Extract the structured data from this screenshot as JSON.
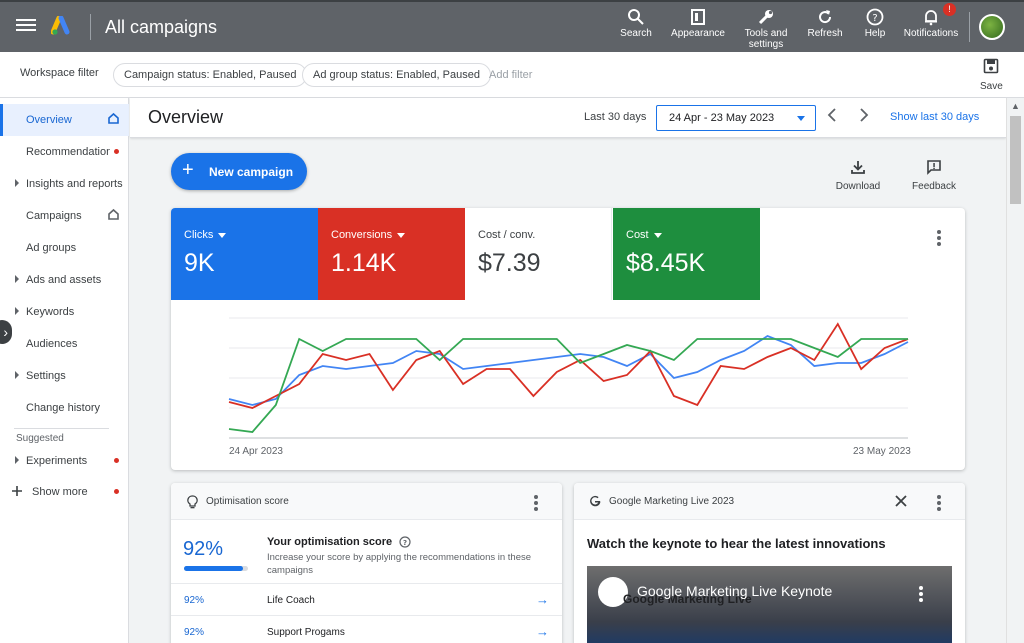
{
  "topbar": {
    "title": "All campaigns",
    "actions": [
      {
        "label": "Search",
        "icon": "search-icon"
      },
      {
        "label": "Appearance",
        "icon": "appearance-icon"
      },
      {
        "label": "Tools and settings",
        "icon": "wrench-icon"
      },
      {
        "label": "Refresh",
        "icon": "refresh-icon"
      },
      {
        "label": "Help",
        "icon": "help-icon"
      },
      {
        "label": "Notifications",
        "icon": "bell-icon",
        "badge": "!"
      }
    ]
  },
  "filterbar": {
    "label": "Workspace filter",
    "chips": [
      "Campaign status: Enabled, Paused",
      "Ad group status: Enabled, Paused"
    ],
    "add_filter": "Add filter",
    "save_label": "Save"
  },
  "sidebar": {
    "items": [
      {
        "label": "Overview",
        "active": true,
        "home": true
      },
      {
        "label": "Recommendations",
        "dot": true
      },
      {
        "label": "Insights and reports",
        "caret": true
      },
      {
        "label": "Campaigns",
        "home": true
      },
      {
        "label": "Ad groups"
      },
      {
        "label": "Ads and assets",
        "caret": true
      },
      {
        "label": "Keywords",
        "caret": true
      },
      {
        "label": "Audiences"
      },
      {
        "label": "Settings",
        "caret": true
      },
      {
        "label": "Change history"
      }
    ],
    "suggested_label": "Suggested",
    "experiments_label": "Experiments",
    "show_more_label": "Show more"
  },
  "overview": {
    "title": "Overview",
    "range_label": "Last 30 days",
    "date_range": "24 Apr - 23 May 2023",
    "show_last": "Show last 30 days",
    "new_campaign": "New campaign",
    "download": "Download",
    "feedback": "Feedback"
  },
  "metrics": [
    {
      "label": "Clicks",
      "value": "9K",
      "color": "#1a73e8",
      "dropdown": true
    },
    {
      "label": "Conversions",
      "value": "1.14K",
      "color": "#d93025",
      "dropdown": true
    },
    {
      "label": "Cost / conv.",
      "value": "$7.39",
      "color": "#ffffff",
      "dropdown": false
    },
    {
      "label": "Cost",
      "value": "$8.45K",
      "color": "#1e8e3e",
      "dropdown": true
    }
  ],
  "chart_data": {
    "type": "line",
    "x_start_label": "24 Apr 2023",
    "x_end_label": "23 May 2023",
    "grid": true,
    "ylim": [
      0,
      4
    ],
    "series": [
      {
        "name": "Clicks",
        "color": "#4285f4",
        "values": [
          1.3,
          1.1,
          1.3,
          2.1,
          2.4,
          2.3,
          2.4,
          2.5,
          2.9,
          2.8,
          2.3,
          2.4,
          2.5,
          2.6,
          2.7,
          2.8,
          2.7,
          2.4,
          2.8,
          2.0,
          2.2,
          2.6,
          2.9,
          3.4,
          3.1,
          2.4,
          2.5,
          2.5,
          2.8,
          3.2
        ]
      },
      {
        "name": "Conversions",
        "color": "#d93025",
        "values": [
          1.2,
          1.0,
          1.4,
          1.8,
          2.8,
          2.6,
          2.8,
          1.6,
          2.6,
          2.9,
          1.8,
          2.3,
          2.3,
          1.4,
          2.2,
          2.6,
          1.9,
          2.1,
          2.9,
          1.4,
          1.1,
          2.4,
          2.3,
          2.7,
          3.0,
          2.6,
          3.8,
          2.3,
          3.0,
          3.3
        ]
      },
      {
        "name": "Cost",
        "color": "#34a853",
        "values": [
          0.3,
          0.2,
          1.1,
          3.3,
          2.9,
          3.3,
          3.3,
          3.3,
          3.3,
          2.6,
          3.3,
          3.3,
          3.3,
          3.3,
          3.3,
          2.5,
          2.8,
          3.1,
          2.9,
          2.6,
          3.3,
          3.3,
          3.3,
          3.3,
          3.3,
          3.0,
          2.7,
          3.3,
          3.3,
          3.3
        ]
      }
    ]
  },
  "optimisation": {
    "title": "Optimisation score",
    "score": "92%",
    "score_fraction": 0.92,
    "heading": "Your optimisation score",
    "description": "Increase your score by applying the recommendations in these campaigns",
    "rows": [
      {
        "pct": "92%",
        "name": "Life Coach"
      },
      {
        "pct": "92%",
        "name": "Support Progams"
      }
    ]
  },
  "gml": {
    "title": "Google Marketing Live 2023",
    "heading": "Watch the keynote to hear the latest innovations",
    "video_title": "Google Marketing Live Keynote",
    "video_logo_text": "Google Marketing Live"
  }
}
